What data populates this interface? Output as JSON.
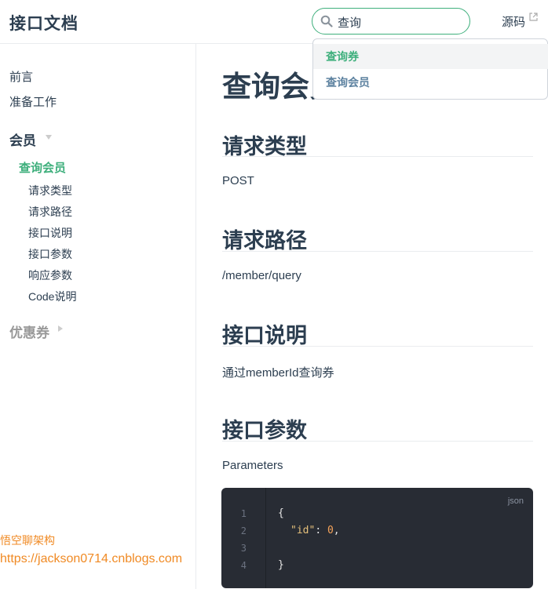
{
  "header": {
    "site_name": "接口文档",
    "search_value": "查询",
    "source_label": "源码"
  },
  "suggestions": [
    "查询券",
    "查询会员"
  ],
  "sidebar": {
    "links": [
      "前言",
      "准备工作"
    ],
    "group_member": "会员",
    "active_page": "查询会员",
    "sub_items": [
      "请求类型",
      "请求路径",
      "接口说明",
      "接口参数",
      "响应参数",
      "Code说明"
    ],
    "group_coupon": "优惠券",
    "footer_name": "悟空聊架构",
    "footer_url": "https://jackson0714.cnblogs.com"
  },
  "content": {
    "title": "查询会员",
    "sections": [
      {
        "heading": "请求类型",
        "text": "POST"
      },
      {
        "heading": "请求路径",
        "text": "/member/query"
      },
      {
        "heading": "接口说明",
        "text": "通过memberId查询券"
      },
      {
        "heading": "接口参数",
        "text": "Parameters"
      }
    ],
    "code": {
      "lang": "json",
      "line_numbers": [
        "1",
        "2",
        "3",
        "4"
      ],
      "open_brace": "{",
      "key": "\"id\"",
      "colon": ": ",
      "value": "0",
      "comma": ",",
      "close_brace": "}"
    }
  },
  "colors": {
    "accent": "#3eaf7c",
    "text": "#2c3e50",
    "footer": "#f08a24",
    "code_bg": "#282c34"
  }
}
